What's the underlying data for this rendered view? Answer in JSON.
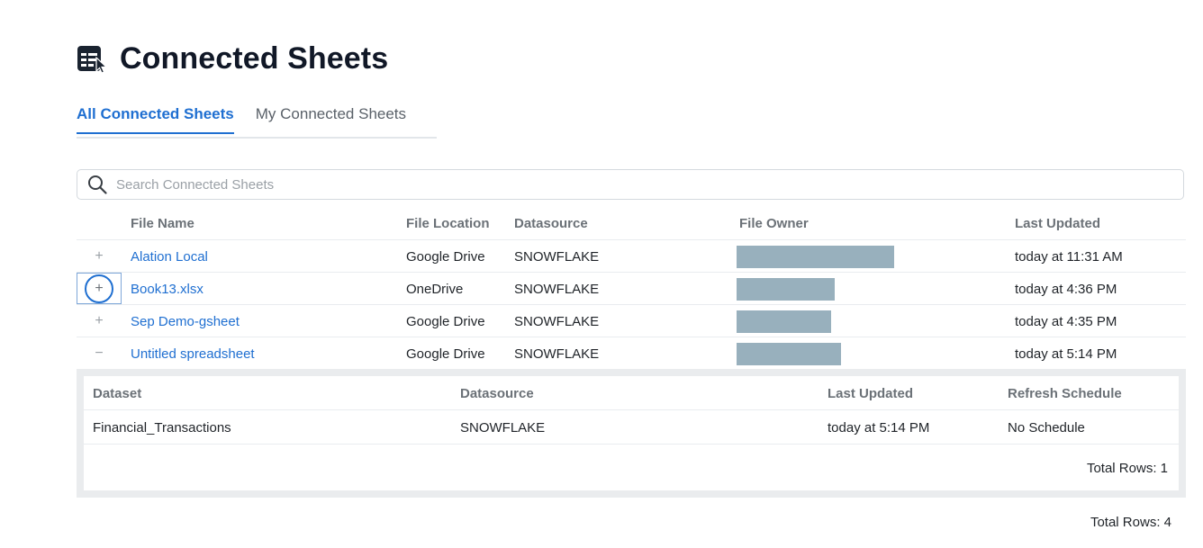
{
  "header": {
    "title": "Connected Sheets",
    "icon": "sheet-pointer-icon"
  },
  "tabs": [
    {
      "label": "All Connected Sheets",
      "active": true
    },
    {
      "label": "My Connected Sheets",
      "active": false
    }
  ],
  "search": {
    "placeholder": "Search Connected Sheets",
    "value": ""
  },
  "table": {
    "columns": [
      "File Name",
      "File Location",
      "Datasource",
      "File Owner",
      "Last Updated"
    ],
    "rows": [
      {
        "toggle": "+",
        "name": "Alation Local",
        "location": "Google Drive",
        "datasource": "SNOWFLAKE",
        "last_updated": "today at 11:31 AM"
      },
      {
        "toggle": "+",
        "name": "Book13.xlsx",
        "location": "OneDrive",
        "datasource": "SNOWFLAKE",
        "last_updated": "today at 4:36 PM"
      },
      {
        "toggle": "+",
        "name": "Sep Demo-gsheet",
        "location": "Google Drive",
        "datasource": "SNOWFLAKE",
        "last_updated": "today at 4:35 PM"
      },
      {
        "toggle": "−",
        "name": "Untitled spreadsheet",
        "location": "Google Drive",
        "datasource": "SNOWFLAKE",
        "last_updated": "today at 5:14 PM"
      }
    ],
    "expanded": {
      "columns": [
        "Dataset",
        "Datasource",
        "Last Updated",
        "Refresh Schedule"
      ],
      "rows": [
        {
          "dataset": "Financial_Transactions",
          "datasource": "SNOWFLAKE",
          "last_updated": "today at 5:14 PM",
          "schedule": "No Schedule"
        }
      ],
      "total": "Total Rows: 1"
    },
    "total": "Total Rows: 4"
  },
  "colors": {
    "accent": "#1f6fd1",
    "owner_redaction": "#98b0bd"
  }
}
